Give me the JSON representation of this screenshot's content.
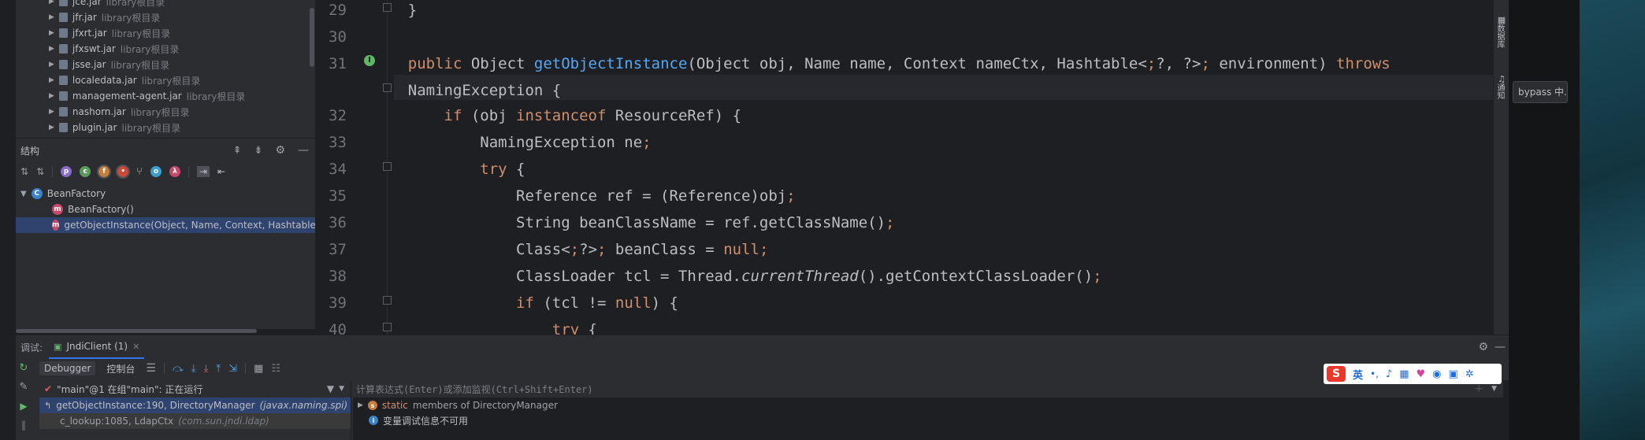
{
  "project_tree": {
    "items": [
      {
        "name": "jce.jar",
        "tag": "library根目录"
      },
      {
        "name": "jfr.jar",
        "tag": "library根目录"
      },
      {
        "name": "jfxrt.jar",
        "tag": "library根目录"
      },
      {
        "name": "jfxswt.jar",
        "tag": "library根目录"
      },
      {
        "name": "jsse.jar",
        "tag": "library根目录"
      },
      {
        "name": "localedata.jar",
        "tag": "library根目录"
      },
      {
        "name": "management-agent.jar",
        "tag": "library根目录"
      },
      {
        "name": "nashorn.jar",
        "tag": "library根目录"
      },
      {
        "name": "plugin.jar",
        "tag": "library根目录"
      }
    ]
  },
  "structure": {
    "title": "结构",
    "class_name": "BeanFactory",
    "members": [
      "BeanFactory()",
      "getObjectInstance(Object, Name, Context, Hashtable"
    ]
  },
  "editor": {
    "lines": [
      {
        "n": "29",
        "t": "    }"
      },
      {
        "n": "30",
        "t": ""
      },
      {
        "n": "31",
        "t": "    public Object getObjectInstance(Object obj, Name name, Context nameCtx, Hashtable<?, ?> environment) throws"
      },
      {
        "n": "",
        "t": "    NamingException {"
      },
      {
        "n": "32",
        "t": "        if (obj instanceof ResourceRef) {"
      },
      {
        "n": "33",
        "t": "            NamingException ne;"
      },
      {
        "n": "34",
        "t": "            try {"
      },
      {
        "n": "35",
        "t": "                Reference ref = (Reference)obj;"
      },
      {
        "n": "36",
        "t": "                String beanClassName = ref.getClassName();"
      },
      {
        "n": "37",
        "t": "                Class<?> beanClass = null;"
      },
      {
        "n": "38",
        "t": "                ClassLoader tcl = Thread.currentThread().getContextClassLoader();"
      },
      {
        "n": "39",
        "t": "                if (tcl != null) {"
      },
      {
        "n": "40",
        "t": "                    try {"
      }
    ]
  },
  "right_strip": {
    "label1": "数据库",
    "label2": "通知"
  },
  "tooltip": "bypass 中...",
  "debug": {
    "label": "调试:",
    "tab": "JndiClient (1)",
    "tab_debugger": "Debugger",
    "tab_console": "控制台",
    "thread": "\"main\"@1 在组\"main\": 正在运行",
    "frames": [
      {
        "method": "getObjectInstance:190, DirectoryManager",
        "pkg": "(javax.naming.spi)"
      },
      {
        "method": "c_lookup:1085, LdapCtx",
        "pkg": "(com.sun.jndi.ldap)"
      }
    ],
    "eval_placeholder": "计算表达式(Enter)或添加监视(Ctrl+Shift+Enter)",
    "var_static": "static",
    "var_static_rest": "members of DirectoryManager",
    "var_info": "变量调试信息不可用"
  },
  "ime": {
    "lang": "英"
  }
}
